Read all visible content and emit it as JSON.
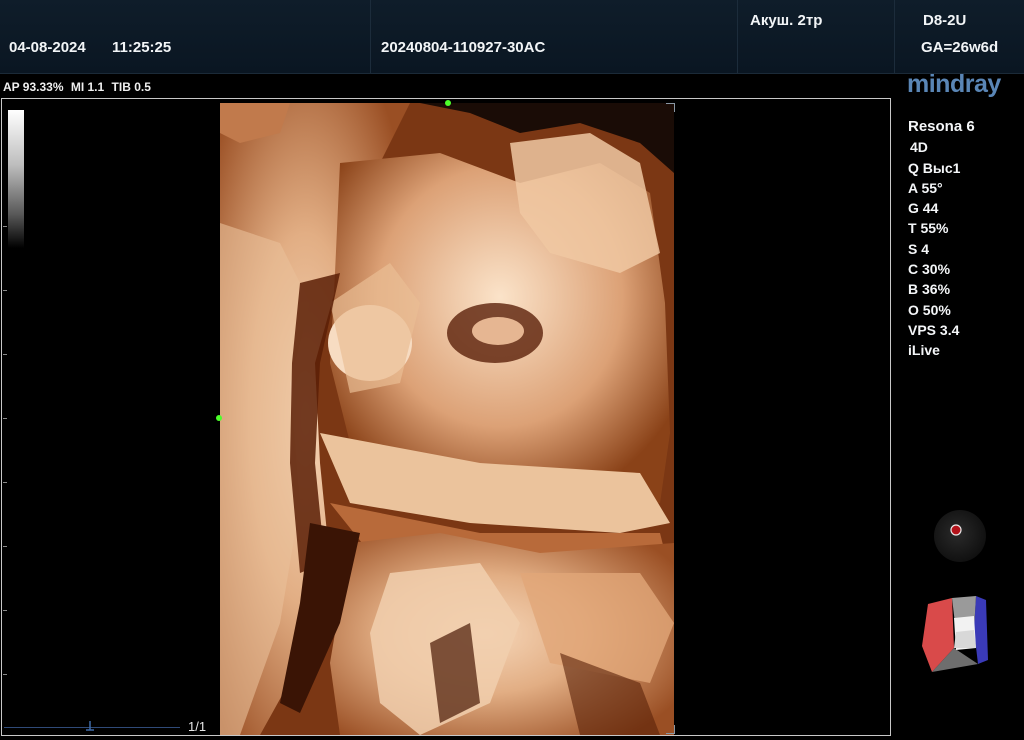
{
  "header": {
    "date": "04-08-2024",
    "time": "11:25:25",
    "patient_id": "20240804-110927-30AC",
    "exam": "Акуш. 2тр",
    "probe": "D8-2U",
    "ga": "GA=26w6d"
  },
  "acoustic": {
    "ap": "AP 93.33%",
    "mi": "MI 1.1",
    "tib": "TIB 0.5"
  },
  "brand": {
    "logo": "mindray",
    "logo_color": "#5a86b6"
  },
  "params": {
    "model": "Resona 6",
    "mode": "4D",
    "items": [
      "Q Выс1",
      "A 55°",
      "G 44",
      "T 55%",
      "S 4",
      "C 30%",
      "B 36%",
      "O 50%",
      "VPS 3.4",
      "iLive"
    ]
  },
  "page_indicator": "1/1",
  "colors": {
    "marker": "#4cff2a",
    "render_tone": "#c98a5c",
    "cube_red": "#d94a4a",
    "cube_blue": "#3a3ab8"
  }
}
